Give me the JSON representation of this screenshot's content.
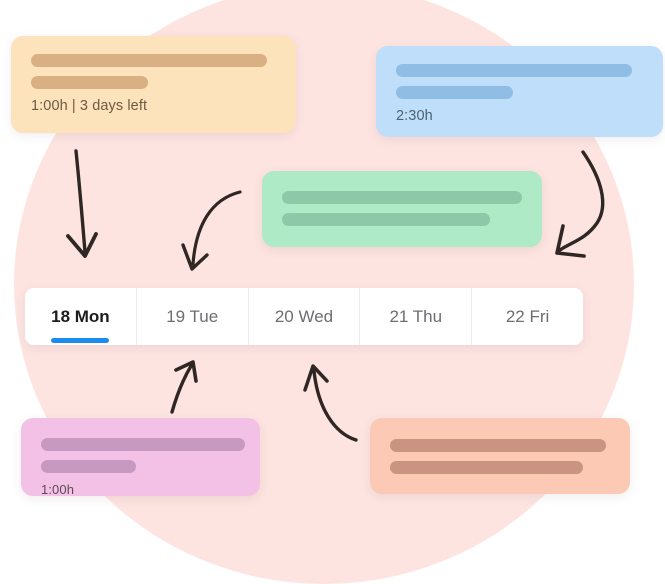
{
  "theme": {
    "background_blob_color": "#fde4e1",
    "accent_color": "#1d8cf0",
    "page_background": "#ffffff"
  },
  "cards": {
    "orange": {
      "name": "task-card-orange",
      "color": "#fde3bb",
      "bar_color": "#d8b083",
      "meta": "1:00h | 3 days left"
    },
    "blue": {
      "name": "task-card-blue",
      "color": "#bfdefa",
      "bar_color": "#8fbde4",
      "meta": "2:30h"
    },
    "green": {
      "name": "task-card-green",
      "color": "#aeeac6",
      "bar_color": "#8dc9a9",
      "meta": ""
    },
    "pink": {
      "name": "task-card-pink",
      "color": "#f3c1e5",
      "bar_color": "#c899c0",
      "meta": "1:00h"
    },
    "salmon": {
      "name": "task-card-salmon",
      "color": "#fbc9b4",
      "bar_color": "#ca9482",
      "meta": ""
    }
  },
  "day_tabs": {
    "active_index": 0,
    "items": [
      {
        "label": "18 Mon",
        "active": true
      },
      {
        "label": "19 Tue",
        "active": false
      },
      {
        "label": "20 Wed",
        "active": false
      },
      {
        "label": "21 Thu",
        "active": false
      },
      {
        "label": "22 Fri",
        "active": false
      }
    ]
  },
  "arrows": [
    {
      "name": "arrow-orange-to-mon",
      "direction": "down"
    },
    {
      "name": "arrow-curve-to-tue",
      "direction": "down-left"
    },
    {
      "name": "arrow-blue-to-fri",
      "direction": "down-left"
    },
    {
      "name": "arrow-pink-to-tue",
      "direction": "up-right"
    },
    {
      "name": "arrow-salmon-to-wed",
      "direction": "up-left"
    }
  ]
}
